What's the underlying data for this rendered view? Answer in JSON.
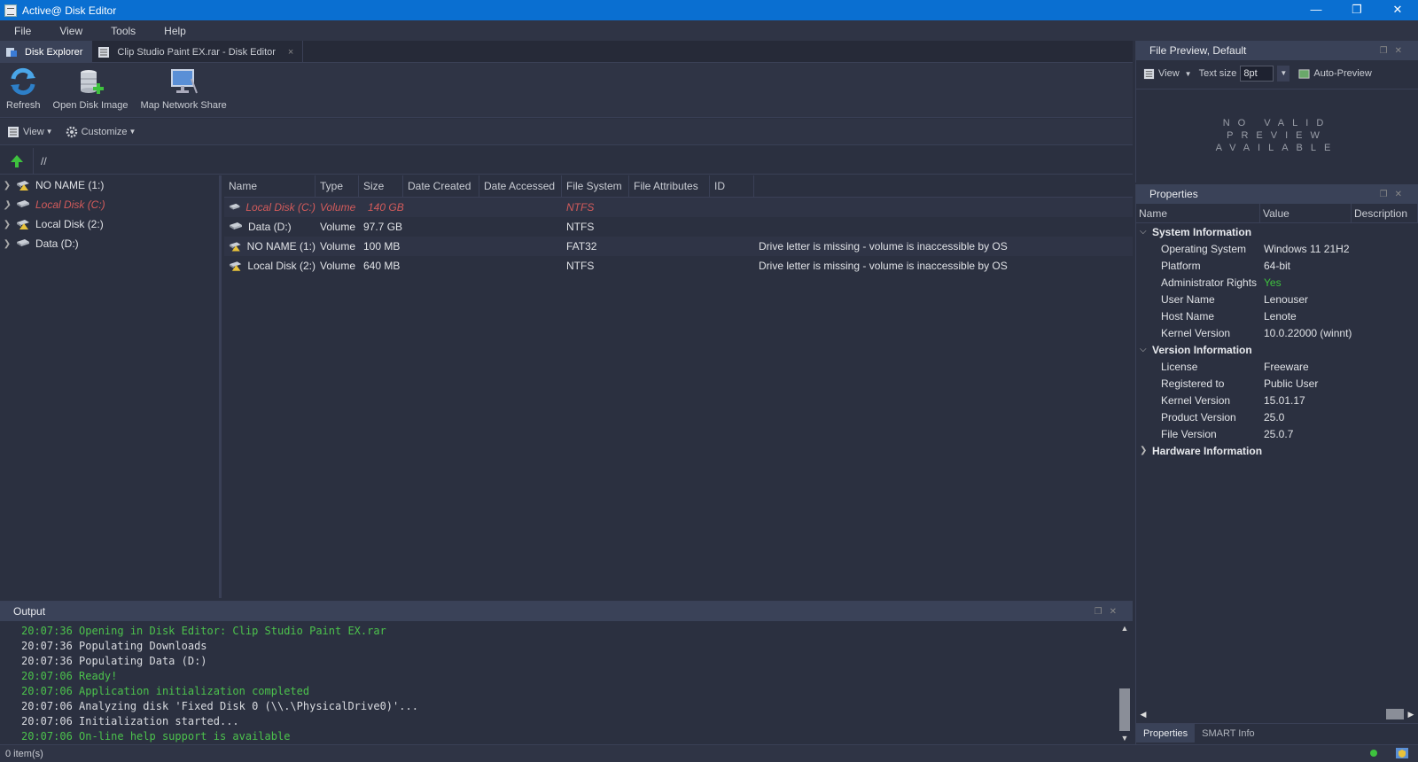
{
  "window": {
    "title": "Active@ Disk Editor",
    "minimize": "—",
    "restore": "❐",
    "close": "✕"
  },
  "menu": [
    "File",
    "View",
    "Tools",
    "Help"
  ],
  "tabs": [
    {
      "label": "Disk Explorer"
    },
    {
      "label": "Clip Studio Paint EX.rar - Disk Editor",
      "close": "×"
    }
  ],
  "ribbon": {
    "refresh": "Refresh",
    "open_image": "Open Disk Image",
    "map_share": "Map Network Share"
  },
  "subtoolbar": {
    "view": "View",
    "customize": "Customize"
  },
  "path": "//",
  "tree": [
    {
      "label": "NO NAME (1:)"
    },
    {
      "label": "Local Disk (C:)"
    },
    {
      "label": "Local Disk (2:)"
    },
    {
      "label": "Data (D:)"
    }
  ],
  "grid": {
    "columns": [
      "Name",
      "Type",
      "Size",
      "Date Created",
      "Date Accessed",
      "File System",
      "File Attributes",
      "ID"
    ],
    "rows": [
      {
        "name": "Local Disk (C:)",
        "type": "Volume",
        "size": "140 GB",
        "fs": "NTFS",
        "note": ""
      },
      {
        "name": "Data (D:)",
        "type": "Volume",
        "size": "97.7 GB",
        "fs": "NTFS",
        "note": ""
      },
      {
        "name": "NO NAME (1:)",
        "type": "Volume",
        "size": "100 MB",
        "fs": "FAT32",
        "note": "Drive letter is missing - volume is inaccessible by OS"
      },
      {
        "name": "Local Disk (2:)",
        "type": "Volume",
        "size": "640 MB",
        "fs": "NTFS",
        "note": "Drive letter is missing - volume is inaccessible by OS"
      }
    ]
  },
  "output": {
    "title": "Output",
    "lines": [
      {
        "text": "20:07:36 Opening in Disk Editor: Clip Studio Paint EX.rar"
      },
      {
        "text": "20:07:36 Populating Downloads"
      },
      {
        "text": "20:07:36 Populating Data (D:)"
      },
      {
        "text": "20:07:06 Ready!"
      },
      {
        "text": "20:07:06 Application initialization completed"
      },
      {
        "text": "20:07:06 Analyzing disk 'Fixed Disk 0 (\\\\.\\PhysicalDrive0)'..."
      },
      {
        "text": "20:07:06 Initialization started..."
      },
      {
        "text": "20:07:06 On-line help support is available"
      }
    ]
  },
  "status": {
    "items": "0 item(s)"
  },
  "preview": {
    "title": "File Preview, Default",
    "view": "View",
    "text_size_label": "Text size",
    "text_size_value": "8pt",
    "auto_preview": "Auto-Preview",
    "no_preview": "NO VALID PREVIEW AVAILABLE"
  },
  "properties": {
    "title": "Properties",
    "columns": [
      "Name",
      "Value",
      "Description"
    ],
    "groups": [
      {
        "name": "System Information",
        "rows": [
          {
            "name": "Operating System",
            "value": "Windows 11 21H2"
          },
          {
            "name": "Platform",
            "value": "64-bit"
          },
          {
            "name": "Administrator Rights",
            "value": "Yes"
          },
          {
            "name": "User Name",
            "value": "Lenouser"
          },
          {
            "name": "Host Name",
            "value": "Lenote"
          },
          {
            "name": "Kernel Version",
            "value": "10.0.22000 (winnt)"
          }
        ]
      },
      {
        "name": "Version Information",
        "rows": [
          {
            "name": "License",
            "value": "Freeware"
          },
          {
            "name": "Registered to",
            "value": "Public User"
          },
          {
            "name": "Kernel Version",
            "value": "15.01.17"
          },
          {
            "name": "Product Version",
            "value": "25.0"
          },
          {
            "name": "File Version",
            "value": "25.0.7"
          }
        ]
      },
      {
        "name": "Hardware Information",
        "rows": []
      }
    ],
    "tabs": [
      "Properties",
      "SMART Info"
    ]
  },
  "colors": {
    "titlebar": "#0a6fd1",
    "accent_green": "#3ec23e",
    "warning_red": "#d35b5b",
    "background": "#2b3040"
  }
}
